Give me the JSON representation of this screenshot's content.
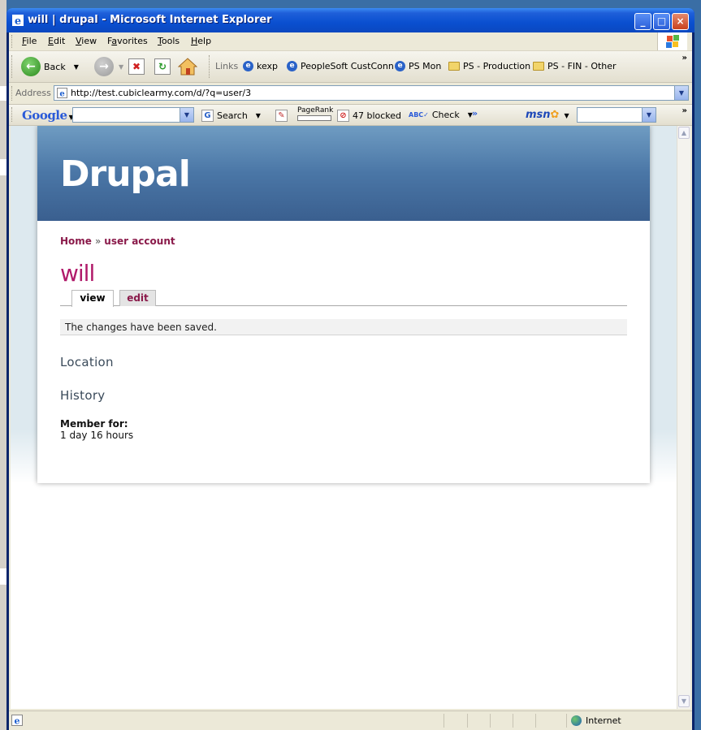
{
  "window": {
    "title": "will | drupal - Microsoft Internet Explorer",
    "controls": [
      "_",
      "□",
      "×"
    ]
  },
  "menu": {
    "items": [
      {
        "label": "File",
        "accel": "F",
        "rest": "ile"
      },
      {
        "label": "Edit",
        "accel": "E",
        "rest": "dit"
      },
      {
        "label": "View",
        "accel": "V",
        "rest": "iew"
      },
      {
        "label": "Favorites",
        "accel": "a",
        "pre": "F",
        "rest": "vorites"
      },
      {
        "label": "Tools",
        "accel": "T",
        "rest": "ools"
      },
      {
        "label": "Help",
        "accel": "H",
        "rest": "elp"
      }
    ]
  },
  "toolbar": {
    "back_label": "Back",
    "links_label": "Links",
    "links": [
      {
        "label": "kexp",
        "icon": "ie-page-icon"
      },
      {
        "label": "PeopleSoft CustConn",
        "icon": "ie-page-icon"
      },
      {
        "label": "PS Mon",
        "icon": "ie-page-icon"
      },
      {
        "label": "PS - Production",
        "icon": "folder-icon"
      },
      {
        "label": "PS - FIN - Other",
        "icon": "folder-icon"
      }
    ]
  },
  "address": {
    "label": "Address",
    "url": "http://test.cubiclearmy.com/d/?q=user/3"
  },
  "googlebar": {
    "logo": "Google",
    "search_label": "Search",
    "pagerank_label": "PageRank",
    "blocked_label": "47 blocked",
    "check_label": "Check",
    "msn_label": "msn"
  },
  "page": {
    "site_name": "Drupal",
    "breadcrumb": {
      "home": "Home",
      "separator": "»",
      "current": "user account"
    },
    "title": "will",
    "tabs": [
      {
        "label": "view",
        "active": true
      },
      {
        "label": "edit",
        "active": false
      }
    ],
    "message": "The changes have been saved.",
    "sections": {
      "location": "Location",
      "history": "History"
    },
    "member_for_label": "Member for:",
    "member_for_value": "1 day 16 hours"
  },
  "status": {
    "zone": "Internet"
  },
  "colors": {
    "title_bar": "#0a4fd0",
    "header_top": "#6f9cc2",
    "header_bottom": "#3a5f8f",
    "link": "#8a1a4a",
    "page_title": "#b01a6a"
  }
}
